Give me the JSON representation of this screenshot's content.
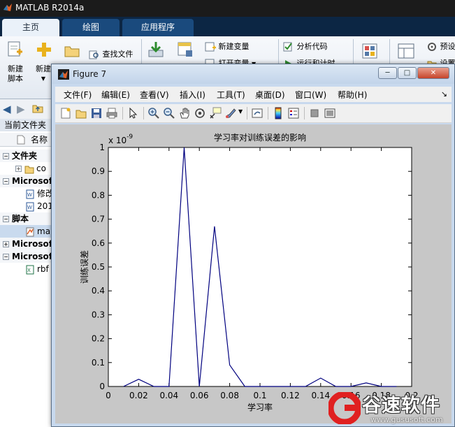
{
  "matlab": {
    "title": "MATLAB R2014a",
    "tabs": [
      "主页",
      "绘图",
      "应用程序"
    ],
    "ribbon": {
      "new_script": "新建\n脚本",
      "new": "新建",
      "find_files": "查找文件",
      "new_variable": "新建变量",
      "open_variable": "打开变量",
      "analyze_code": "分析代码",
      "run_and_time": "运行和计时",
      "preferences": "预设",
      "settings": "设置"
    },
    "current_folder": {
      "header": "当前文件夹",
      "name_column": "名称",
      "tree": [
        {
          "label": "文件夹",
          "type": "group"
        },
        {
          "label": "co",
          "type": "folder"
        },
        {
          "label": "Microsof",
          "type": "group"
        },
        {
          "label": "修改",
          "type": "doc"
        },
        {
          "label": "201",
          "type": "doc"
        },
        {
          "label": "脚本",
          "type": "group"
        },
        {
          "label": "ma",
          "type": "mfile"
        },
        {
          "label": "Microsof",
          "type": "group"
        },
        {
          "label": "Microsof",
          "type": "group"
        },
        {
          "label": "rbf",
          "type": "xls"
        }
      ]
    }
  },
  "figure": {
    "title": "Figure 7",
    "menus": [
      "文件(F)",
      "编辑(E)",
      "查看(V)",
      "插入(I)",
      "工具(T)",
      "桌面(D)",
      "窗口(W)",
      "帮助(H)"
    ],
    "win_buttons": {
      "minimize": "─",
      "maximize": "□",
      "close": "✕"
    }
  },
  "chart_data": {
    "type": "line",
    "title": "学习率对训练误差的影响",
    "xlabel": "学习率",
    "ylabel": "训练误差",
    "y_multiplier": "x 10",
    "y_exponent": "-9",
    "xlim": [
      0,
      0.2
    ],
    "ylim": [
      0,
      1
    ],
    "xticks": [
      "0",
      "0.02",
      "0.04",
      "0.06",
      "0.08",
      "0.1",
      "0.12",
      "0.14",
      "0.16",
      "0.18",
      "0.2"
    ],
    "yticks": [
      "0",
      "0.1",
      "0.2",
      "0.3",
      "0.4",
      "0.5",
      "0.6",
      "0.7",
      "0.8",
      "0.9",
      "1"
    ],
    "grid": false,
    "line_color": "#00007f",
    "series": [
      {
        "x": [
          0.01,
          0.02,
          0.03,
          0.04,
          0.05,
          0.06,
          0.07,
          0.08,
          0.09,
          0.1,
          0.11,
          0.12,
          0.13,
          0.14,
          0.15,
          0.16,
          0.17,
          0.18,
          0.19
        ],
        "values": [
          0,
          0.03,
          0,
          0,
          1.0,
          0,
          0.67,
          0.09,
          0,
          0,
          0,
          0,
          0,
          0.035,
          0,
          0,
          0.015,
          0,
          0
        ]
      }
    ]
  },
  "watermark": {
    "text": "谷速软件",
    "url": "www.gususoft.com"
  }
}
